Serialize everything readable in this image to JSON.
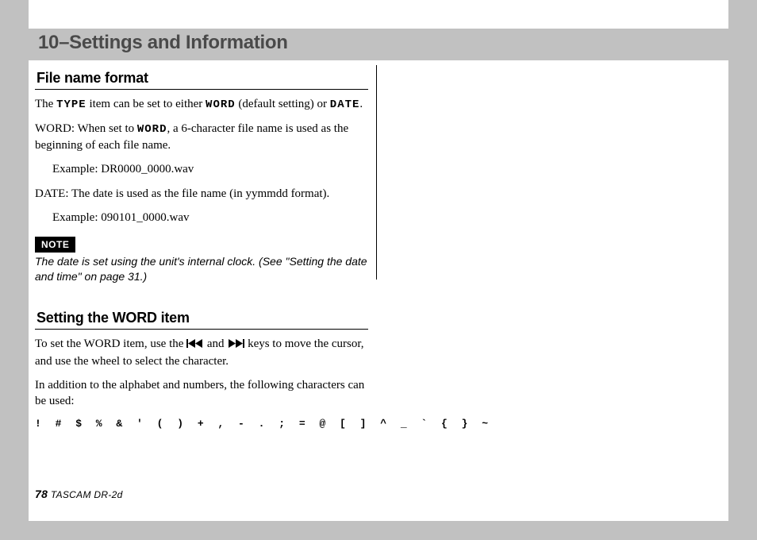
{
  "chapter": {
    "title": "10–Settings and Information"
  },
  "section1": {
    "title": "File name format",
    "p1_a": "The ",
    "p1_type": "TYPE",
    "p1_b": " item can be set to either ",
    "p1_word": "WORD",
    "p1_c": " (default setting) or ",
    "p1_date": "DATE",
    "p1_d": ".",
    "p2_a": "WORD: When set to ",
    "p2_word": "WORD",
    "p2_b": ", a 6-character file name is used as the beginning of each file name.",
    "ex1": "Example: DR0000_0000.wav",
    "p3": "DATE: The date is used as the file name (in yymmdd format).",
    "ex2": "Example: 090101_0000.wav",
    "note_label": "NOTE",
    "note_body": "The date is set using the unit's internal clock. (See \"Setting the date and time\" on page 31.)"
  },
  "section2": {
    "title": "Setting the WORD item",
    "p1_a": "To set the WORD item, use the ",
    "p1_b": " and ",
    "p1_c": " keys to move the cursor, and use the wheel to select the character.",
    "p2": "In addition to the alphabet and numbers, the following characters can be used:",
    "chars": "! # $ % & ' ( ) + , - . ; = @ [ ] ^ _ ` { } ~"
  },
  "icons": {
    "prev": "skip-back-icon",
    "next": "skip-forward-icon"
  },
  "footer": {
    "page": "78",
    "product": "TASCAM  DR-2d"
  }
}
